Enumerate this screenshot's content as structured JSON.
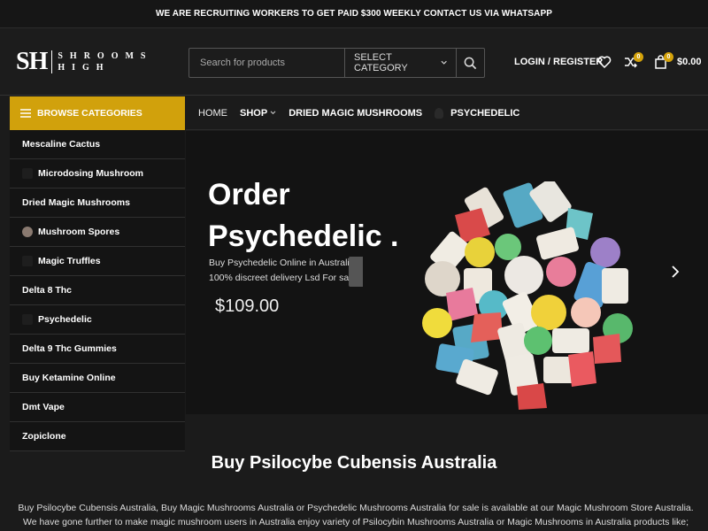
{
  "topbar": {
    "text": "WE ARE RECRUITING WORKERS TO GET PAID $300 WEEKLY CONTACT US VIA WHATSAPP"
  },
  "logo": {
    "mark": "SH",
    "line1": "SHROOMS",
    "line2": "HIGH"
  },
  "search": {
    "placeholder": "Search for products",
    "category": "SELECT CATEGORY"
  },
  "header": {
    "login": "LOGIN / REGISTER",
    "compare_count": "0",
    "cart_count": "0",
    "cart_total": "$0.00"
  },
  "browse": {
    "label": "BROWSE CATEGORIES"
  },
  "categories": [
    {
      "label": "Mescaline Cactus"
    },
    {
      "label": "Microdosing Mushroom"
    },
    {
      "label": "Dried Magic Mushrooms"
    },
    {
      "label": "Mushroom Spores"
    },
    {
      "label": "Magic Truffles"
    },
    {
      "label": "Delta 8 Thc"
    },
    {
      "label": "Psychedelic"
    },
    {
      "label": "Delta 9 Thc Gummies"
    },
    {
      "label": "Buy Ketamine Online"
    },
    {
      "label": "Dmt Vape"
    },
    {
      "label": "Zopiclone"
    }
  ],
  "nav": [
    {
      "label": "HOME"
    },
    {
      "label": "SHOP"
    },
    {
      "label": "DRIED MAGIC MUSHROOMS"
    },
    {
      "label": "PSYCHEDELIC"
    }
  ],
  "hero": {
    "title_line1": "Order",
    "title_line2": "Psychedelic .",
    "sub_line1": "Buy Psychedelic Online in Australia",
    "sub_line2": "100% discreet delivery Lsd For sale",
    "price": "$109.00"
  },
  "content": {
    "title": "Buy Psilocybe Cubensis Australia",
    "text": "Buy Psilocybe Cubensis Australia, Buy Magic Mushrooms Australia or Psychedelic Mushrooms Australia for sale is available at our Magic Mushroom Store Australia. We have gone further to make magic mushroom users in Australia enjoy variety of Psilocybin Mushrooms Australia or Magic Mushrooms in Australia products like; Dried Magic"
  },
  "colors": {
    "accent": "#d1a10c",
    "background": "#1b1b1b"
  }
}
